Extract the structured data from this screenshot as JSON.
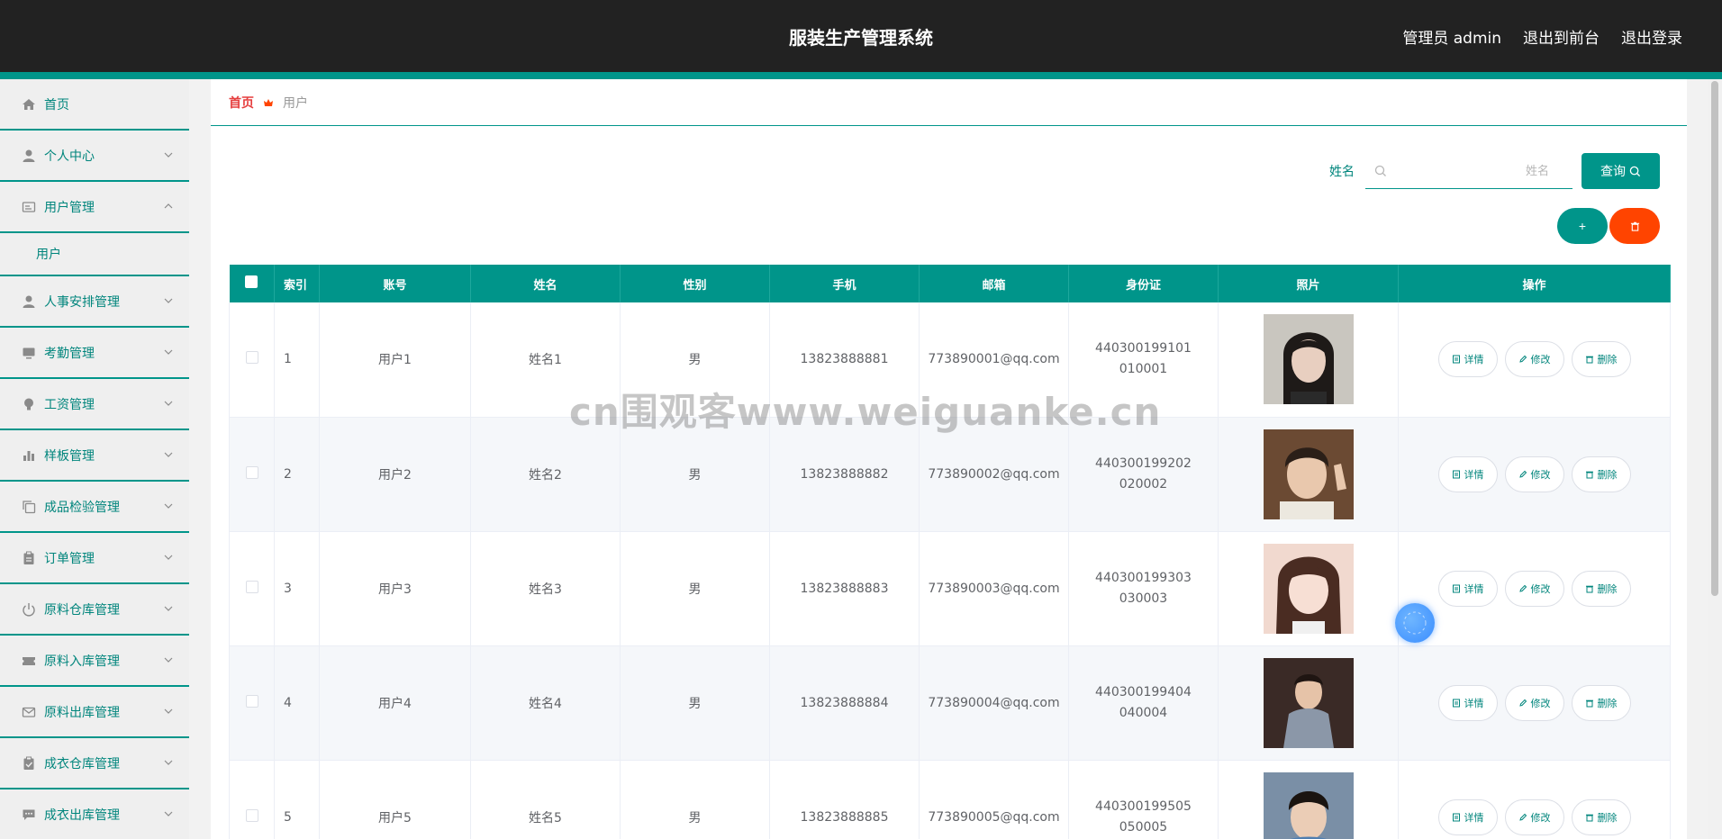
{
  "header": {
    "title": "服装生产管理系统",
    "user_label": "管理员 admin",
    "front_link": "退出到前台",
    "logout_link": "退出登录"
  },
  "sidebar": {
    "items": [
      {
        "label": "首页",
        "icon": "home-icon"
      },
      {
        "label": "个人中心",
        "icon": "user-icon"
      },
      {
        "label": "用户管理",
        "icon": "id-card-icon",
        "expanded": true,
        "children": [
          "用户"
        ]
      },
      {
        "label": "人事安排管理",
        "icon": "user-icon"
      },
      {
        "label": "考勤管理",
        "icon": "monitor-icon"
      },
      {
        "label": "工资管理",
        "icon": "bulb-icon"
      },
      {
        "label": "样板管理",
        "icon": "bar-chart-icon"
      },
      {
        "label": "成品检验管理",
        "icon": "copy-icon"
      },
      {
        "label": "订单管理",
        "icon": "clipboard-icon"
      },
      {
        "label": "原料仓库管理",
        "icon": "power-icon"
      },
      {
        "label": "原料入库管理",
        "icon": "ticket-icon"
      },
      {
        "label": "原料出库管理",
        "icon": "mail-icon"
      },
      {
        "label": "成衣仓库管理",
        "icon": "clipboard-check-icon"
      },
      {
        "label": "成衣出库管理",
        "icon": "chat-icon"
      }
    ]
  },
  "breadcrumb": {
    "home": "首页",
    "current": "用户"
  },
  "search": {
    "label": "姓名",
    "placeholder": "姓名",
    "button": "查询"
  },
  "actions": {
    "add_label": "+"
  },
  "table": {
    "columns": [
      "索引",
      "账号",
      "姓名",
      "性别",
      "手机",
      "邮箱",
      "身份证",
      "照片",
      "操作"
    ],
    "op_labels": {
      "detail": "详情",
      "edit": "修改",
      "delete": "删除"
    },
    "rows": [
      {
        "index": "1",
        "account": "用户1",
        "name": "姓名1",
        "gender": "男",
        "phone": "13823888881",
        "email": "773890001@qq.com",
        "idcard": "440300199101010001"
      },
      {
        "index": "2",
        "account": "用户2",
        "name": "姓名2",
        "gender": "男",
        "phone": "13823888882",
        "email": "773890002@qq.com",
        "idcard": "440300199202020002"
      },
      {
        "index": "3",
        "account": "用户3",
        "name": "姓名3",
        "gender": "男",
        "phone": "13823888883",
        "email": "773890003@qq.com",
        "idcard": "440300199303030003"
      },
      {
        "index": "4",
        "account": "用户4",
        "name": "姓名4",
        "gender": "男",
        "phone": "13823888884",
        "email": "773890004@qq.com",
        "idcard": "440300199404040004"
      },
      {
        "index": "5",
        "account": "用户5",
        "name": "姓名5",
        "gender": "男",
        "phone": "13823888885",
        "email": "773890005@qq.com",
        "idcard": "440300199505050005"
      }
    ]
  },
  "watermark": "cn围观客www.weiguanke.cn",
  "colors": {
    "primary": "#00958a",
    "danger": "#ff4400",
    "header_bg": "#222222",
    "breadcrumb_home": "#e53e3e"
  }
}
